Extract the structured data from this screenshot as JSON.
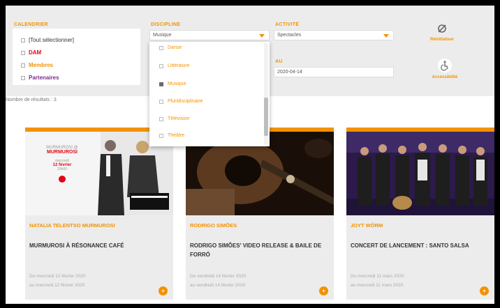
{
  "filters": {
    "calendar": {
      "label": "CALENDRIER",
      "items": [
        {
          "label": "[Tout sélectionner]",
          "color": "#333333"
        },
        {
          "label": "DAM",
          "color": "#e30613"
        },
        {
          "label": "Membres",
          "color": "#f39200"
        },
        {
          "label": "Partenaires",
          "color": "#7b2c87"
        }
      ]
    },
    "discipline": {
      "label": "DISCIPLINE",
      "selected": "Musique",
      "options": [
        {
          "label": "Danse",
          "checked": false
        },
        {
          "label": "Littérature",
          "checked": false
        },
        {
          "label": "Musique",
          "checked": true
        },
        {
          "label": "Pluridisciplinaire",
          "checked": false
        },
        {
          "label": "Télévision",
          "checked": false
        },
        {
          "label": "Théâtre",
          "checked": false
        }
      ]
    },
    "activity": {
      "label": "ACTIVITÉ",
      "selected": "Spectacles"
    },
    "date": {
      "label": "AU",
      "value": "2020-04-14"
    },
    "tools": {
      "reset_label": "Réinitialiser",
      "accessibility_label": "Accessibilité"
    }
  },
  "results": {
    "label": "Nombre de résultats : 3"
  },
  "cards": [
    {
      "artist": "NATALIA TELENTSO MURMUROSI",
      "title": "MURMUROSI À RÉSONANCE CAFÉ",
      "date_start": "Du mercredi 12 février 2020",
      "date_end": "au mercredi 12 février 2020",
      "poster": {
        "line1": "MURMUROSI @",
        "line2": "MURMUROSI",
        "line3": "mercredi",
        "line4": "12 février",
        "line5": "20h00"
      }
    },
    {
      "artist": "RODRIGO SIMÕES",
      "title": "RODRIGO SIMÕES' VIDEO RELEASE & BAILE DE FORRÓ",
      "date_start": "Du vendredi 14 février 2020",
      "date_end": "au vendredi 14 février 2020"
    },
    {
      "artist": "JOYT WÖRM",
      "title": "CONCERT DE LANCEMENT : SANTO SALSA",
      "date_start": "Du mercredi 11 mars 2020",
      "date_end": "au mercredi 11 mars 2020"
    }
  ],
  "colors": {
    "accent": "#f39200",
    "panel": "#ececec"
  }
}
